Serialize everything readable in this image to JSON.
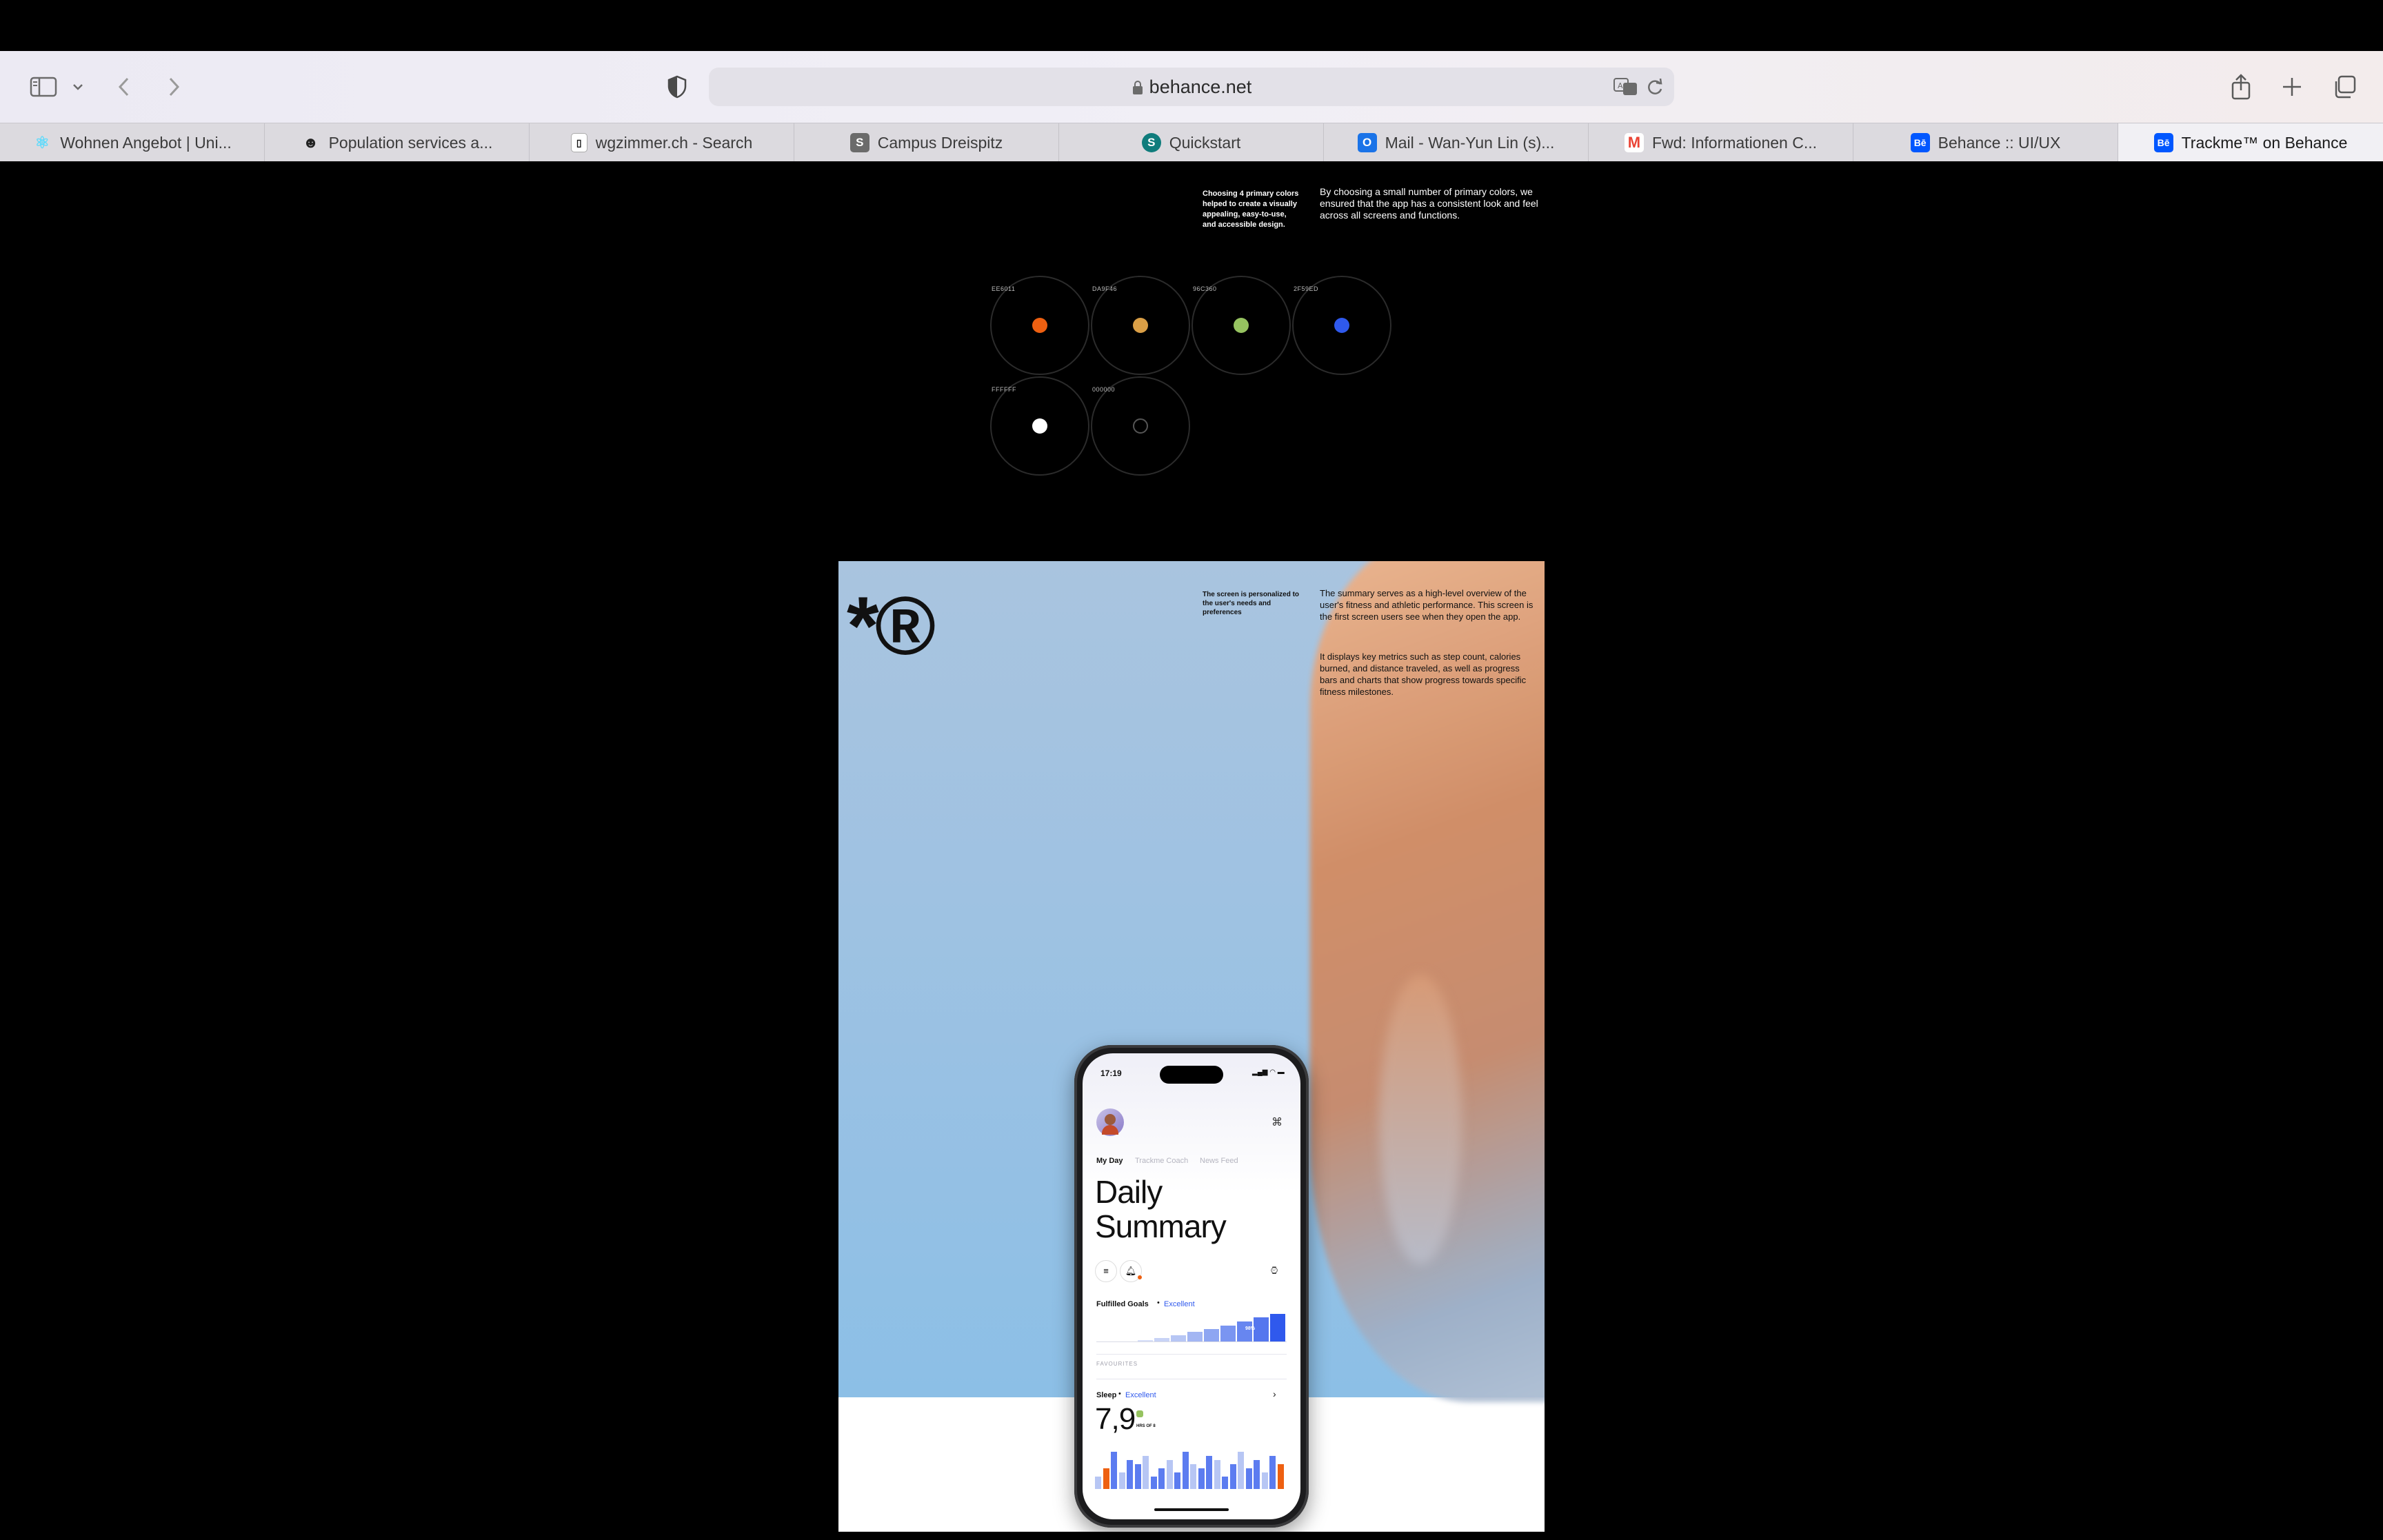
{
  "browser": {
    "url": "behance.net",
    "tabs": [
      {
        "label": "Wohnen Angebot | Uni...",
        "icon": "react-favicon",
        "color": "#61dafb"
      },
      {
        "label": "Population services a...",
        "icon": "people-favicon",
        "color": "#222222"
      },
      {
        "label": "wgzimmer.ch - Search",
        "icon": "wgzimmer-favicon",
        "color": "#111111"
      },
      {
        "label": "Campus Dreispitz",
        "icon": "s-favicon",
        "color": "#6b6b6b",
        "letter": "S"
      },
      {
        "label": "Quickstart",
        "icon": "sharepoint-favicon",
        "color": "#0f7c7c",
        "letter": "S"
      },
      {
        "label": "Mail - Wan-Yun Lin (s)...",
        "icon": "outlook-favicon",
        "color": "#1a73e8",
        "letter": "O"
      },
      {
        "label": "Fwd: Informationen C...",
        "icon": "gmail-favicon",
        "color": "#ea4335",
        "letter": "M"
      },
      {
        "label": "Behance :: UI/UX",
        "icon": "behance-favicon",
        "color": "#0057ff",
        "letter": "Bē"
      },
      {
        "label": "Trackme™ on Behance",
        "icon": "behance-favicon",
        "color": "#0057ff",
        "letter": "Bē"
      }
    ],
    "active_tab": 8
  },
  "colors_section": {
    "note_small": "Choosing 4 primary colors helped to create a visually appealing, easy-to-use, and accessible design.",
    "note_main": "By choosing a small number of primary colors, we ensured that the app has a consistent look and feel across all screens and functions.",
    "swatches": [
      {
        "hex": "EE6011",
        "color": "#ee6011"
      },
      {
        "hex": "DA9F46",
        "color": "#da9f46"
      },
      {
        "hex": "96C360",
        "color": "#96c360"
      },
      {
        "hex": "2F59ED",
        "color": "#2f59ed"
      },
      {
        "hex": "FFFFFF",
        "color": "#ffffff"
      },
      {
        "hex": "000000",
        "color": "#000000"
      }
    ]
  },
  "poster": {
    "logo": "*®",
    "note_small": "The screen is personalized to the user's needs and preferences",
    "para1": "The summary serves as a high-level overview of the user's fitness and athletic performance. This screen is the first screen users see when they open the app.",
    "para2": "It displays key metrics such as step count, calories burned, and distance traveled, as well as progress bars and charts that show progress towards specific fitness milestones."
  },
  "phone": {
    "time": "17:19",
    "tabs": [
      "My Day",
      "Trackme Coach",
      "News Feed"
    ],
    "title_line1": "Daily",
    "title_line2": "Summary",
    "goals_label": "Fulfilled Goals",
    "goals_status": "Excellent",
    "goals_badge": "98%",
    "favourites_label": "FAVOURITES",
    "sleep_label": "Sleep",
    "sleep_status": "Excellent",
    "sleep_value": "7,9",
    "sleep_unit": "HRS OF 8",
    "accent": "#2f59ed"
  }
}
